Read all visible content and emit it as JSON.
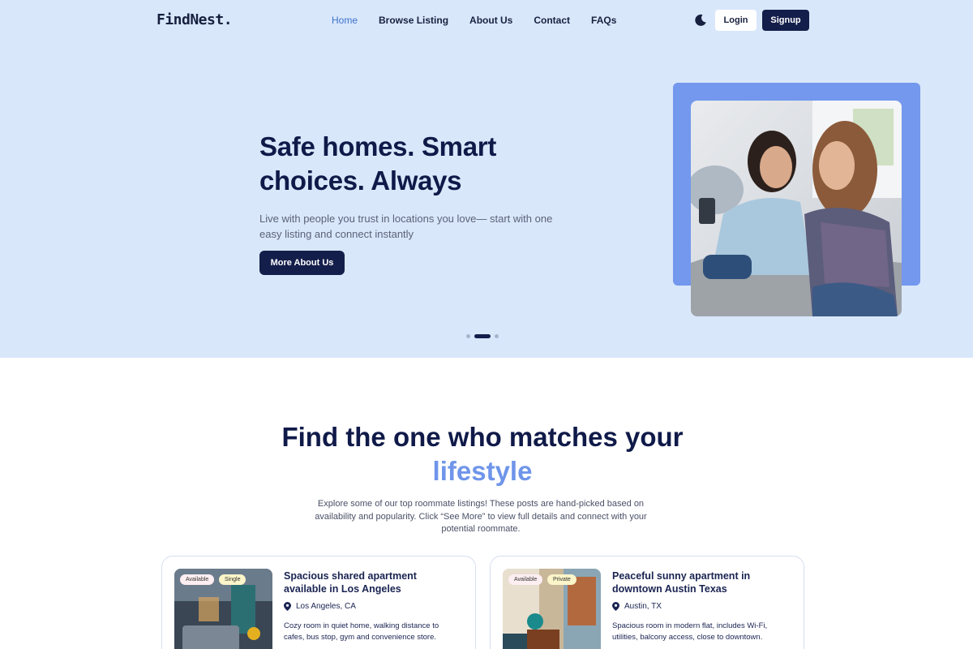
{
  "header": {
    "logo": "FindNest.",
    "nav": [
      "Home",
      "Browse Listing",
      "About Us",
      "Contact",
      "FAQs"
    ],
    "active_nav": "Home",
    "theme_icon": "moon-icon",
    "login_label": "Login",
    "signup_label": "Signup"
  },
  "hero": {
    "title": "Safe homes. Smart choices. Always",
    "subtitle": "Live with people you trust in locations you love— start with one easy listing and connect instantly",
    "cta_label": "More About Us",
    "slides_count": 3,
    "active_slide": 2
  },
  "section": {
    "title_main": "Find the one who matches your",
    "title_accent": "lifestyle",
    "description": "Explore some of our top roommate listings! These posts are hand-picked based on availability and popularity. Click “See More” to view full details and connect with your potential roommate."
  },
  "listings": [
    {
      "badges": [
        "Available",
        "Single"
      ],
      "title": "Spacious shared apartment available in Los Angeles",
      "location": "Los Angeles, CA",
      "description": "Cozy room in quiet home, walking distance to cafes, bus stop, gym and convenience store."
    },
    {
      "badges": [
        "Available",
        "Private"
      ],
      "title": "Peaceful sunny apartment in downtown Austin Texas",
      "location": "Austin, TX",
      "description": "Spacious room in modern flat, includes Wi-Fi, utilities, balcony access, close to downtown."
    }
  ],
  "colors": {
    "navy": "#141e4a",
    "hero_bg": "#d9e7fb",
    "accent_blue": "#6f95ea",
    "active_link": "#3d73c9"
  }
}
